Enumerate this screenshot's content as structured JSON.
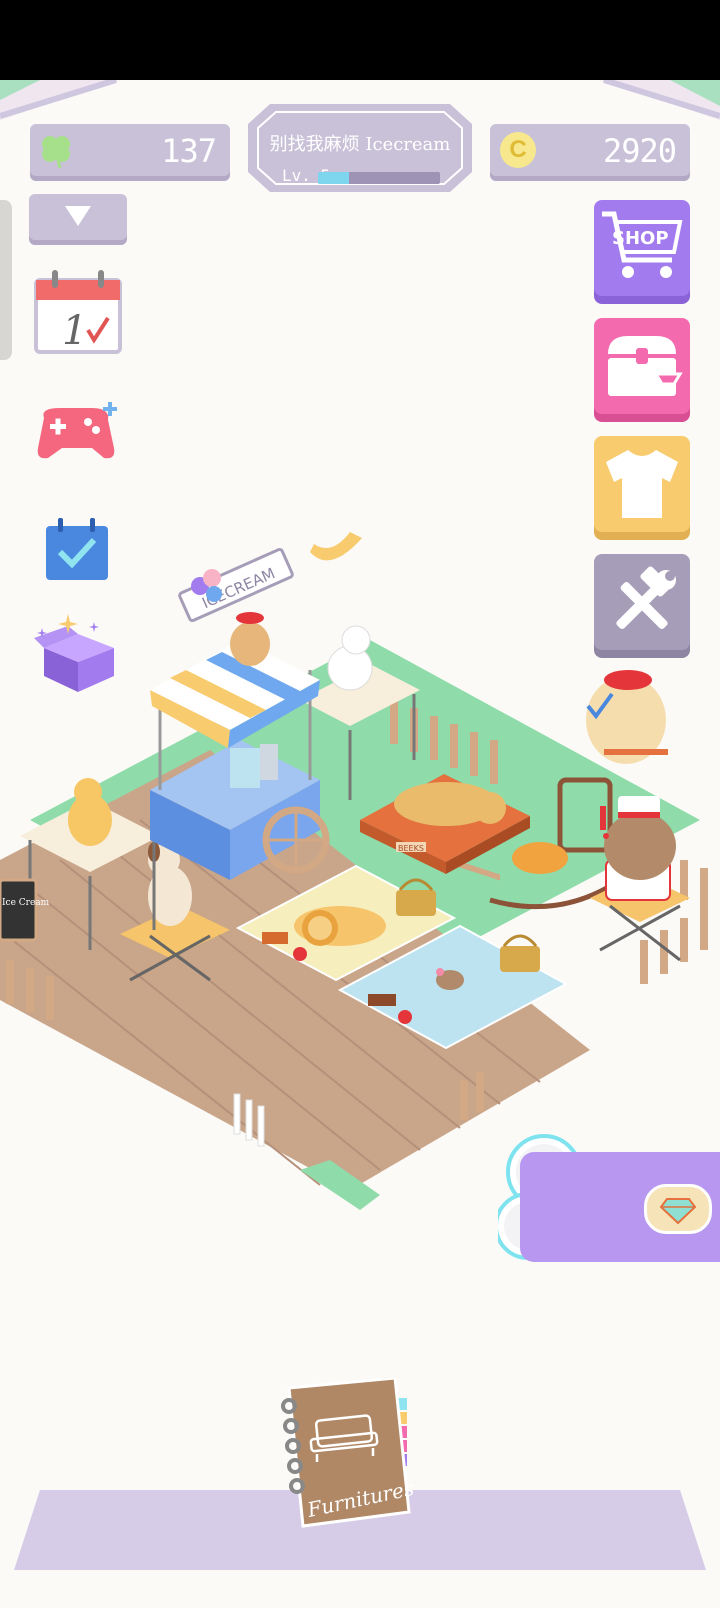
{
  "hud": {
    "clover_count": "137",
    "coin_count": "2920",
    "coin_symbol": "C",
    "cafe_name": "别找我麻烦 Icecream",
    "level_label": "Lv. 5",
    "level_progress": 0.25
  },
  "right_menu": {
    "shop_label": "SHOP"
  },
  "left_menu": {
    "calendar_day": "1"
  },
  "scene": {
    "stand_sign": "ICECREAM",
    "chalkboard_text": "Ice Cream",
    "mat_tag": "BEEKS"
  },
  "bottom": {
    "furniture_book_label": "Furnitures"
  },
  "colors": {
    "hud_pill": "#c9c1d8",
    "shop": "#a27cee",
    "chest": "#f36aae",
    "shirt": "#f8cb6e",
    "tools": "#a69db8",
    "grass": "#8fdcaa",
    "deck": "#c9a58a"
  }
}
